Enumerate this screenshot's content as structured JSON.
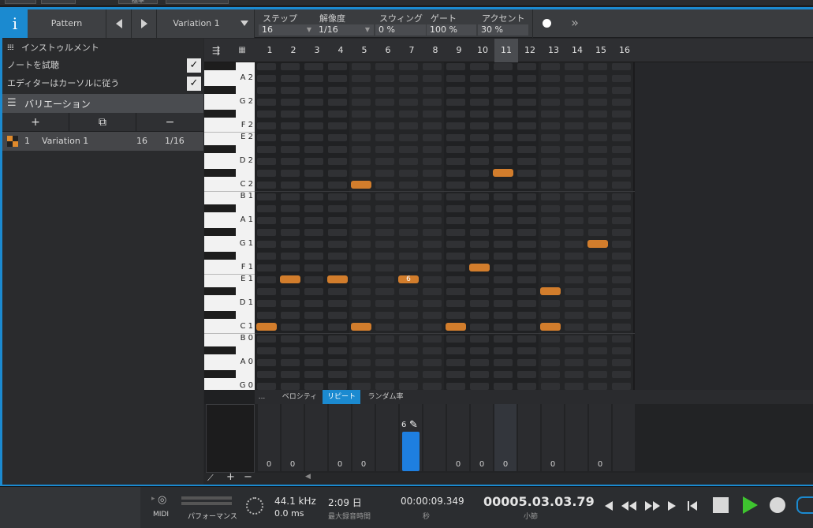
{
  "toolbar": {
    "info_label": "i",
    "pattern_label": "Pattern",
    "variation_label": "Variation 1",
    "params": [
      {
        "label": "ステップ",
        "value": "16"
      },
      {
        "label": "解像度",
        "value": "1/16"
      },
      {
        "label": "スウィング",
        "value": "0 %"
      },
      {
        "label": "ゲート",
        "value": "100 %"
      },
      {
        "label": "アクセント",
        "value": "30 %"
      }
    ],
    "more_label": "»"
  },
  "left_panel": {
    "instrument_label": "インストゥルメント",
    "preview_label": "ノートを試聴",
    "follow_label": "エディターはカーソルに従う",
    "variations_header": "バリエーション",
    "variation_row": {
      "index": "1",
      "name": "Variation 1",
      "steps": "16",
      "resolution": "1/16"
    }
  },
  "editor": {
    "steps": [
      "1",
      "2",
      "3",
      "4",
      "5",
      "6",
      "7",
      "8",
      "9",
      "10",
      "11",
      "12",
      "13",
      "14",
      "15",
      "16"
    ],
    "selected_step": 11,
    "key_labels": [
      "A 2",
      "G 2",
      "F 2",
      "E 2",
      "D 2",
      "C 2",
      "B 1",
      "A 1",
      "G 1",
      "F 1",
      "E 1",
      "D 1",
      "C 1",
      "B 0",
      "A 0",
      "G 0"
    ],
    "notes": [
      {
        "step": 1,
        "pitch": "C 1"
      },
      {
        "step": 2,
        "pitch": "E 1"
      },
      {
        "step": 4,
        "pitch": "E 1"
      },
      {
        "step": 5,
        "pitch": "C 2"
      },
      {
        "step": 5,
        "pitch": "C 1"
      },
      {
        "step": 7,
        "pitch": "E 1",
        "label": "6"
      },
      {
        "step": 9,
        "pitch": "C 1"
      },
      {
        "step": 10,
        "pitch": "F 1"
      },
      {
        "step": 11,
        "pitch": "C# 2"
      },
      {
        "step": 13,
        "pitch": "D# 1"
      },
      {
        "step": 13,
        "pitch": "C 1"
      },
      {
        "step": 15,
        "pitch": "G 1"
      }
    ],
    "lane_tabs": [
      "...",
      "ベロシティ",
      "リピート",
      "ランダム率"
    ],
    "active_lane_tab": "リピート",
    "lane_values": [
      "0",
      "0",
      "",
      "0",
      "0",
      "",
      "6",
      "",
      "0",
      "0",
      "0",
      "",
      "0",
      "",
      "0",
      ""
    ],
    "repeat_edit_value": "6"
  },
  "transport": {
    "midi_label": "MIDI",
    "performance_label": "パフォーマンス",
    "sample_rate": "44.1 kHz",
    "latency": "0.0 ms",
    "record_time": "2:09 日",
    "record_time_label": "最大録音時間",
    "seconds": "00:00:09.349",
    "seconds_label": "秒",
    "bars": "00005.03.03.79",
    "bars_label": "小節"
  },
  "top_strip": {
    "tab_label": "標準"
  },
  "colors": {
    "accent": "#1b8ad0",
    "note": "#d27d2c",
    "play": "#3ec42f"
  }
}
